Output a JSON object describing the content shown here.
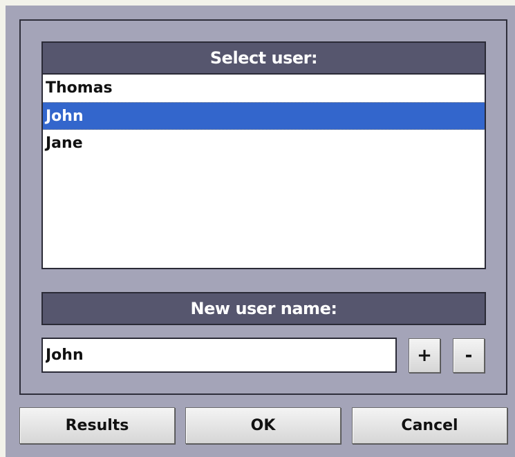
{
  "select_user": {
    "header": "Select user:",
    "users": [
      "Thomas",
      "John",
      "Jane"
    ],
    "selected": "John"
  },
  "new_user": {
    "header": "New user name:",
    "value": "John",
    "add_label": "+",
    "remove_label": "-"
  },
  "footer": {
    "results_label": "Results",
    "ok_label": "OK",
    "cancel_label": "Cancel"
  },
  "colors": {
    "panel_bg": "#a4a4b8",
    "header_bg": "#56566e",
    "selection": "#3366cc"
  }
}
